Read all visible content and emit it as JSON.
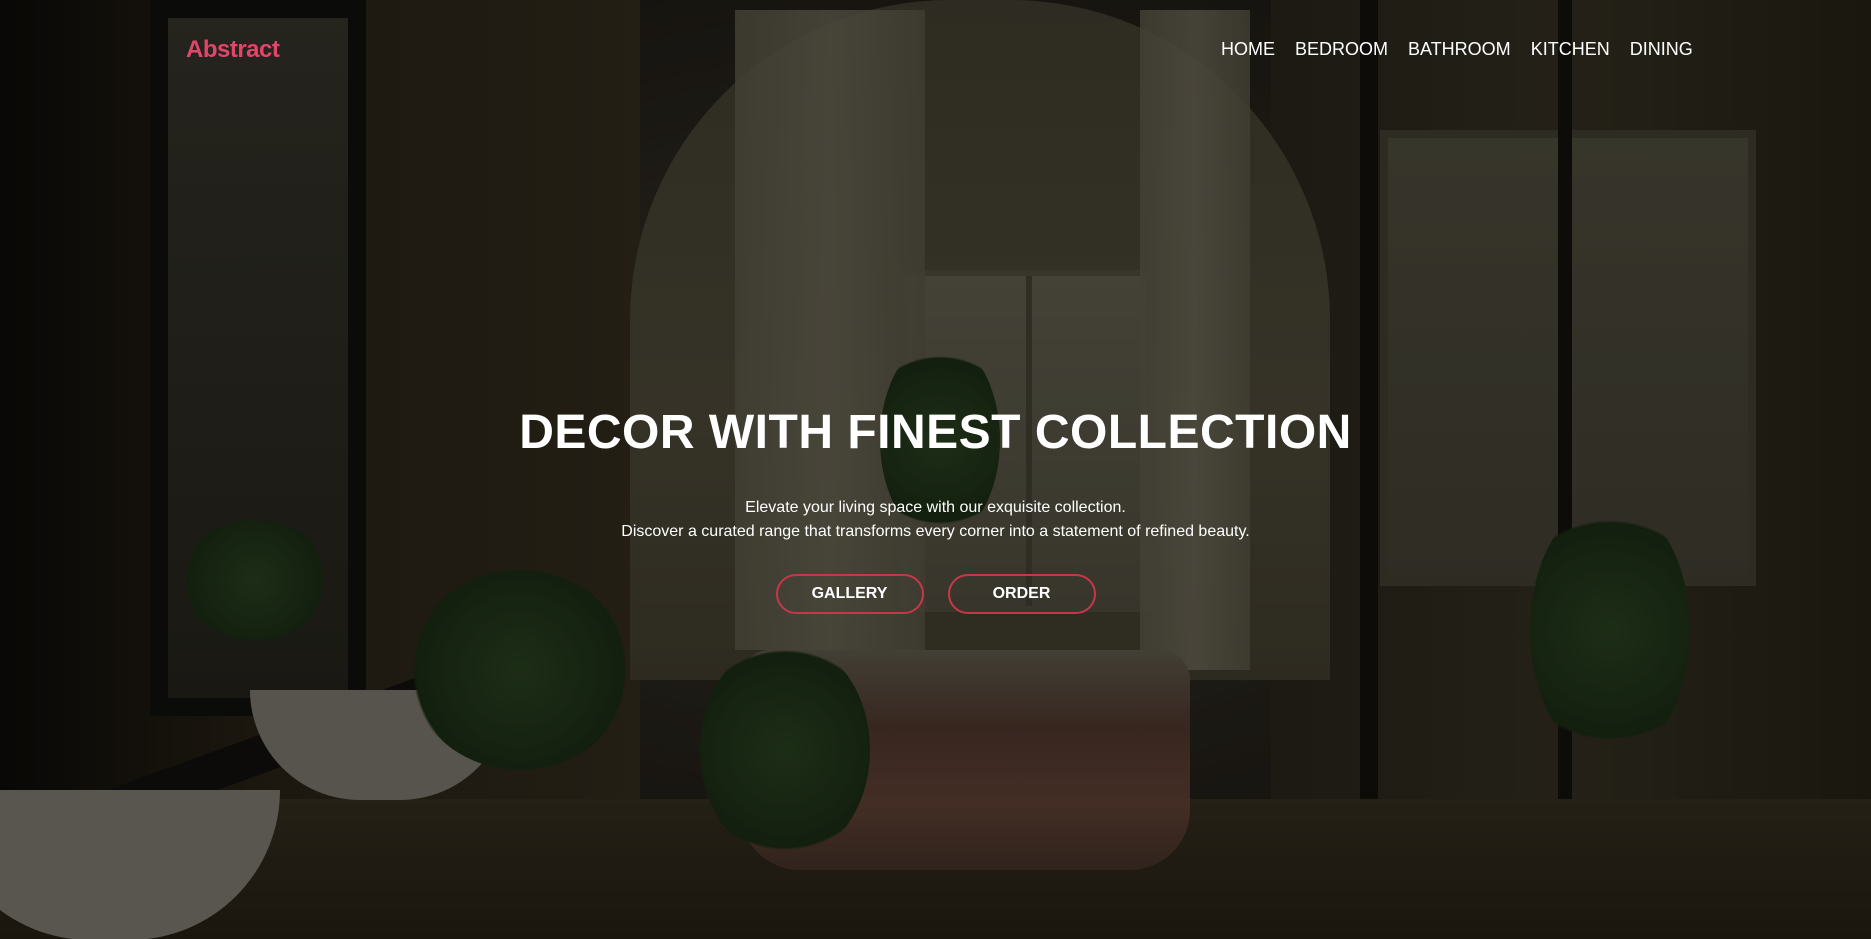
{
  "brand": {
    "logo_text": "Abstract",
    "accent_color": "#e0466a"
  },
  "nav": {
    "items": [
      {
        "label": "HOME"
      },
      {
        "label": "BEDROOM"
      },
      {
        "label": "BATHROOM"
      },
      {
        "label": "KITCHEN"
      },
      {
        "label": "DINING"
      }
    ]
  },
  "hero": {
    "title": "DECOR WITH FINEST COLLECTION",
    "subtitle_line1": "Elevate your living space with our exquisite collection.",
    "subtitle_line2": "Discover a curated range that transforms every corner into a statement of refined beauty.",
    "buttons": {
      "gallery_label": "GALLERY",
      "order_label": "ORDER",
      "border_color": "#c8364a"
    }
  }
}
